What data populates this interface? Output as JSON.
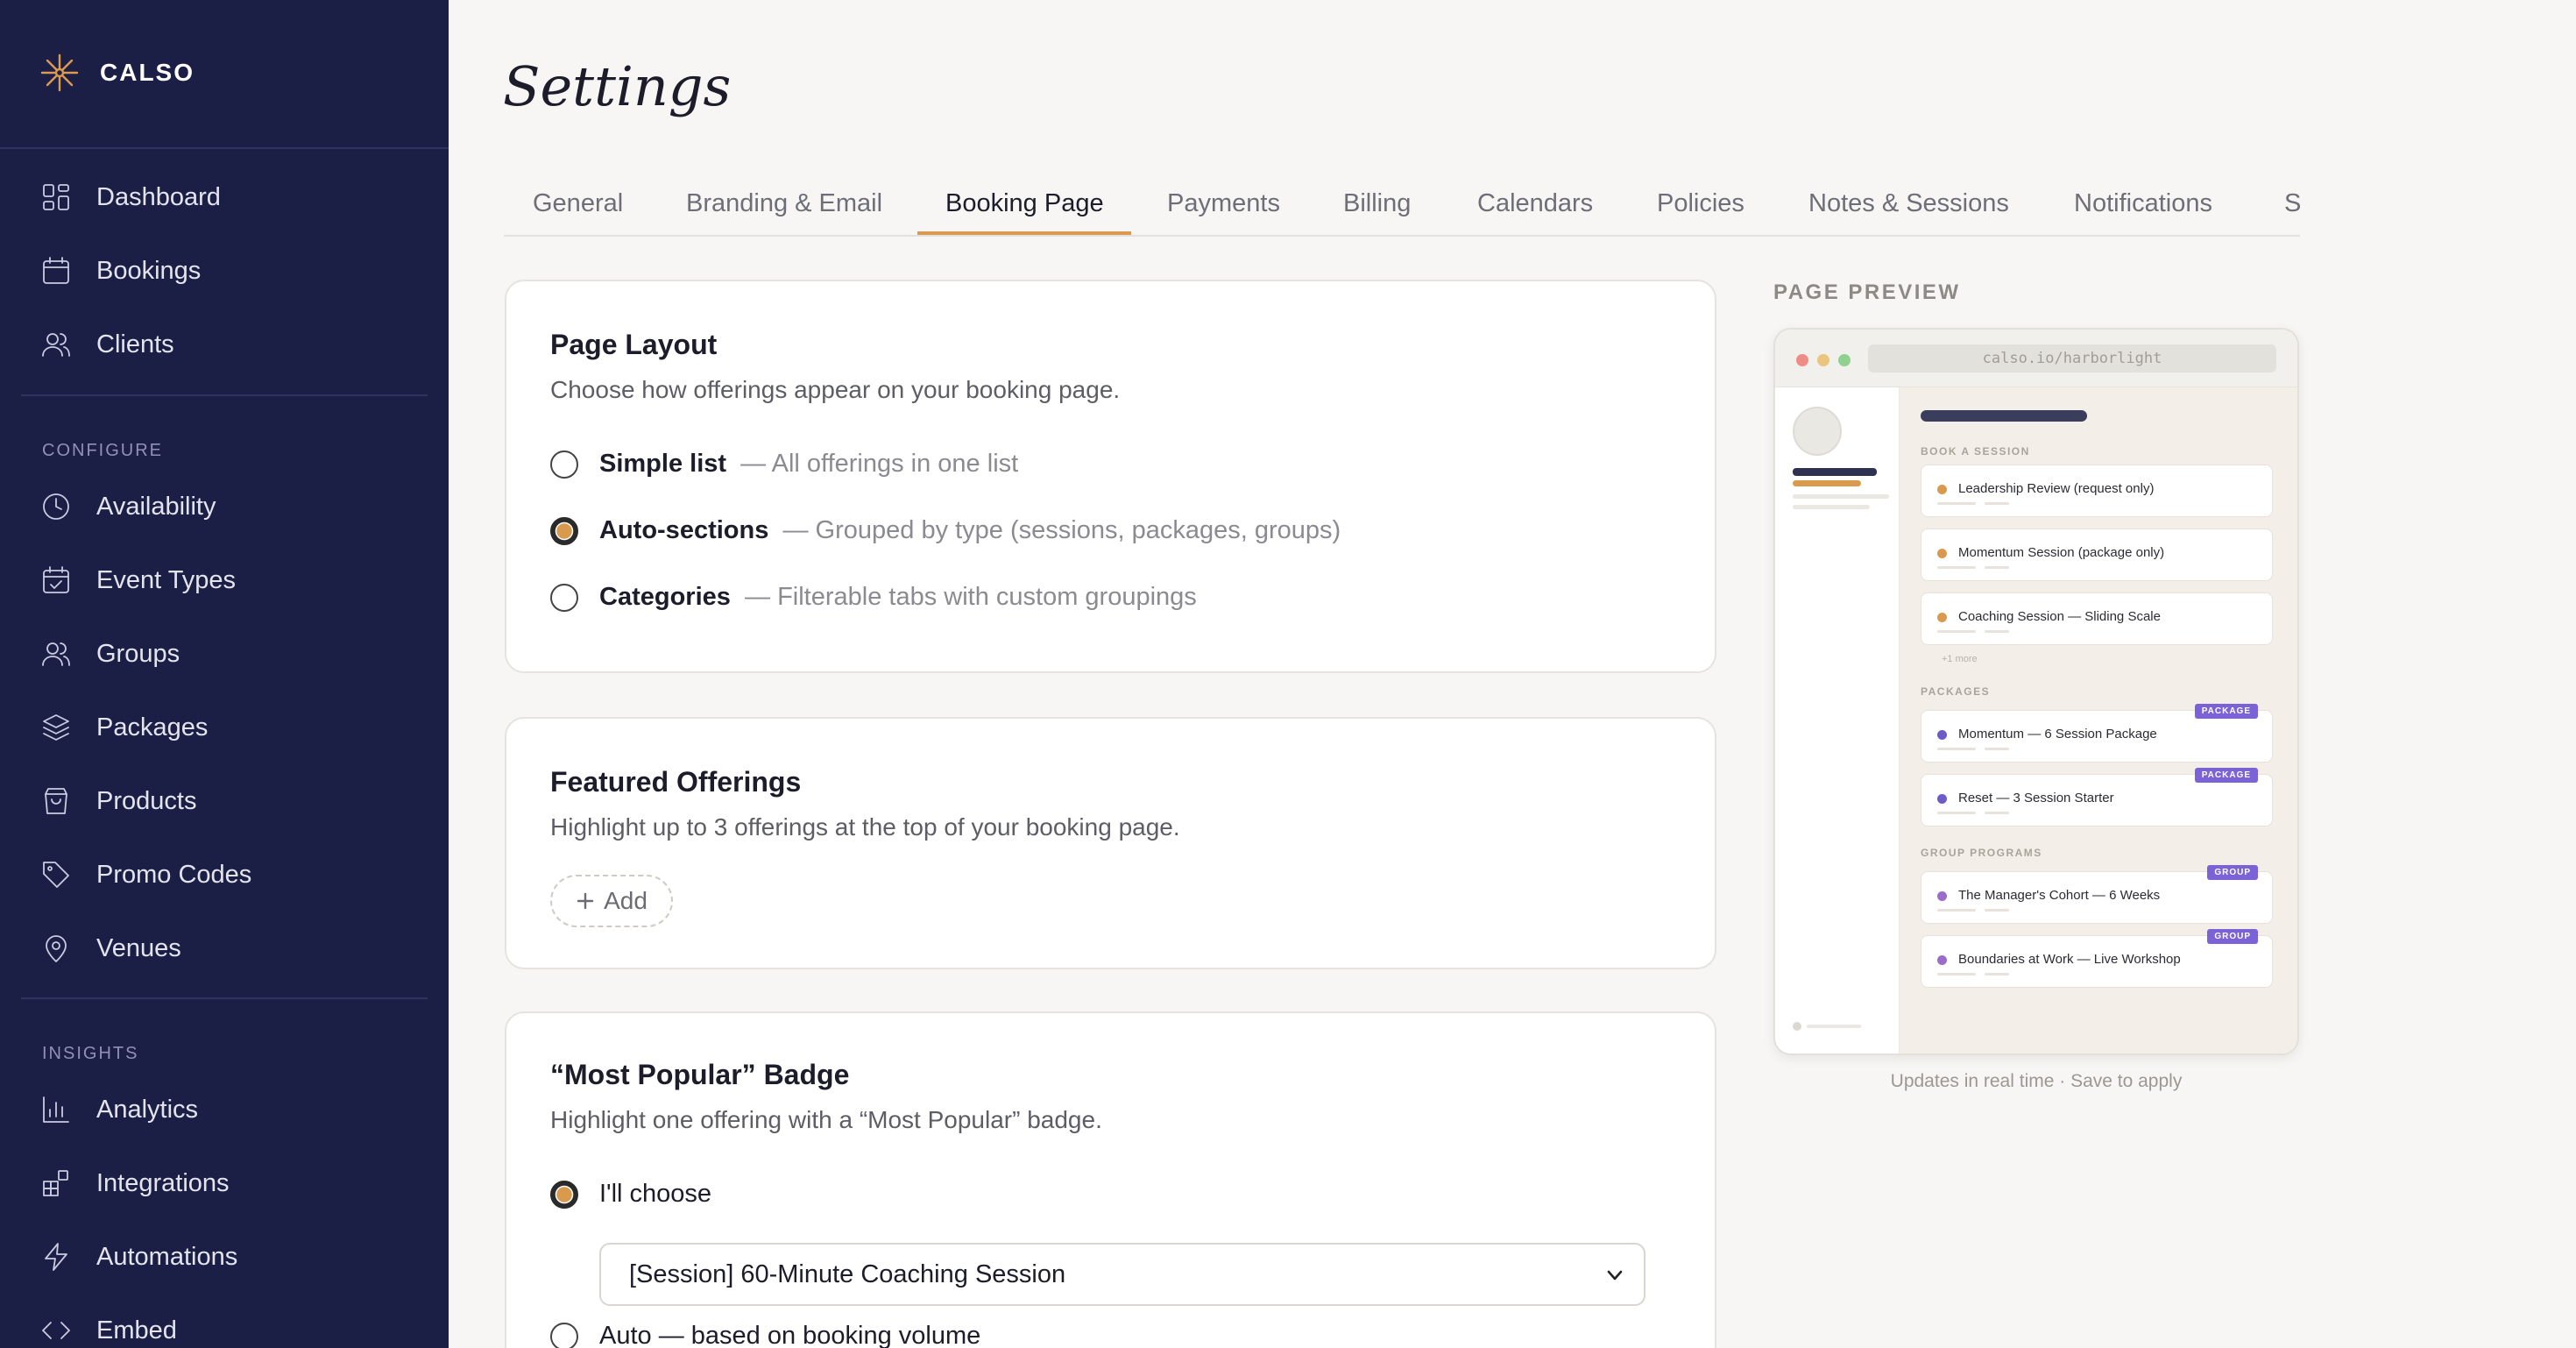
{
  "brand": {
    "name": "CALSO"
  },
  "sidebar": {
    "main_items": [
      {
        "label": "Dashboard",
        "icon": "dashboard-icon"
      },
      {
        "label": "Bookings",
        "icon": "calendar-icon"
      },
      {
        "label": "Clients",
        "icon": "users-icon"
      }
    ],
    "configure_heading": "CONFIGURE",
    "configure_items": [
      {
        "label": "Availability",
        "icon": "clock-icon"
      },
      {
        "label": "Event Types",
        "icon": "calendar-check-icon"
      },
      {
        "label": "Groups",
        "icon": "group-icon"
      },
      {
        "label": "Packages",
        "icon": "layers-icon"
      },
      {
        "label": "Products",
        "icon": "shopping-bag-icon"
      },
      {
        "label": "Promo Codes",
        "icon": "tag-icon"
      },
      {
        "label": "Venues",
        "icon": "map-pin-icon"
      }
    ],
    "insights_heading": "INSIGHTS",
    "insights_items": [
      {
        "label": "Analytics",
        "icon": "bar-chart-icon"
      },
      {
        "label": "Integrations",
        "icon": "integrations-icon"
      },
      {
        "label": "Automations",
        "icon": "lightning-icon"
      },
      {
        "label": "Embed",
        "icon": "code-icon"
      }
    ]
  },
  "page": {
    "title": "Settings"
  },
  "tabs": [
    "General",
    "Branding & Email",
    "Booking Page",
    "Payments",
    "Billing",
    "Calendars",
    "Policies",
    "Notes & Sessions",
    "Notifications",
    "S"
  ],
  "active_tab": "Booking Page",
  "page_layout": {
    "title": "Page Layout",
    "description": "Choose how offerings appear on your booking page.",
    "options": [
      {
        "label": "Simple list",
        "hint": "— All offerings in one list",
        "checked": false
      },
      {
        "label": "Auto-sections",
        "hint": "— Grouped by type (sessions, packages, groups)",
        "checked": true
      },
      {
        "label": "Categories",
        "hint": "— Filterable tabs with custom groupings",
        "checked": false
      }
    ]
  },
  "featured": {
    "title": "Featured Offerings",
    "description": "Highlight up to 3 offerings at the top of your booking page.",
    "add_label": "Add"
  },
  "popular": {
    "title": "“Most Popular” Badge",
    "description": "Highlight one offering with a “Most Popular” badge.",
    "option_choose": "I'll choose",
    "option_auto": "Auto — based on booking volume",
    "selected_offering": "[Session] 60-Minute Coaching Session"
  },
  "preview": {
    "label": "PAGE PREVIEW",
    "url": "calso.io/harborlight",
    "section_book": "BOOK A SESSION",
    "section_packages": "PACKAGES",
    "section_groups": "GROUP PROGRAMS",
    "more_text": "+1 more",
    "sessions": [
      "Leadership Review (request only)",
      "Momentum Session (package only)",
      "Coaching Session — Sliding Scale"
    ],
    "packages": [
      {
        "name": "Momentum — 6 Session Package",
        "badge": "PACKAGE"
      },
      {
        "name": "Reset — 3 Session Starter",
        "badge": "PACKAGE"
      }
    ],
    "groups": [
      {
        "name": "The Manager's Cohort — 6 Weeks",
        "badge": "GROUP"
      },
      {
        "name": "Boundaries at Work — Live Workshop",
        "badge": "GROUP"
      }
    ],
    "caption": "Updates in real time · Save to apply",
    "colors": {
      "session_dot": "#d99a4e",
      "package_dot": "#6c5bc9",
      "group_dot": "#9b6cc9",
      "badge": "#7b62d6"
    }
  },
  "colors": {
    "sidebar_bg": "#1c1f45",
    "accent": "#dc9a50",
    "page_bg": "#f7f6f4"
  }
}
